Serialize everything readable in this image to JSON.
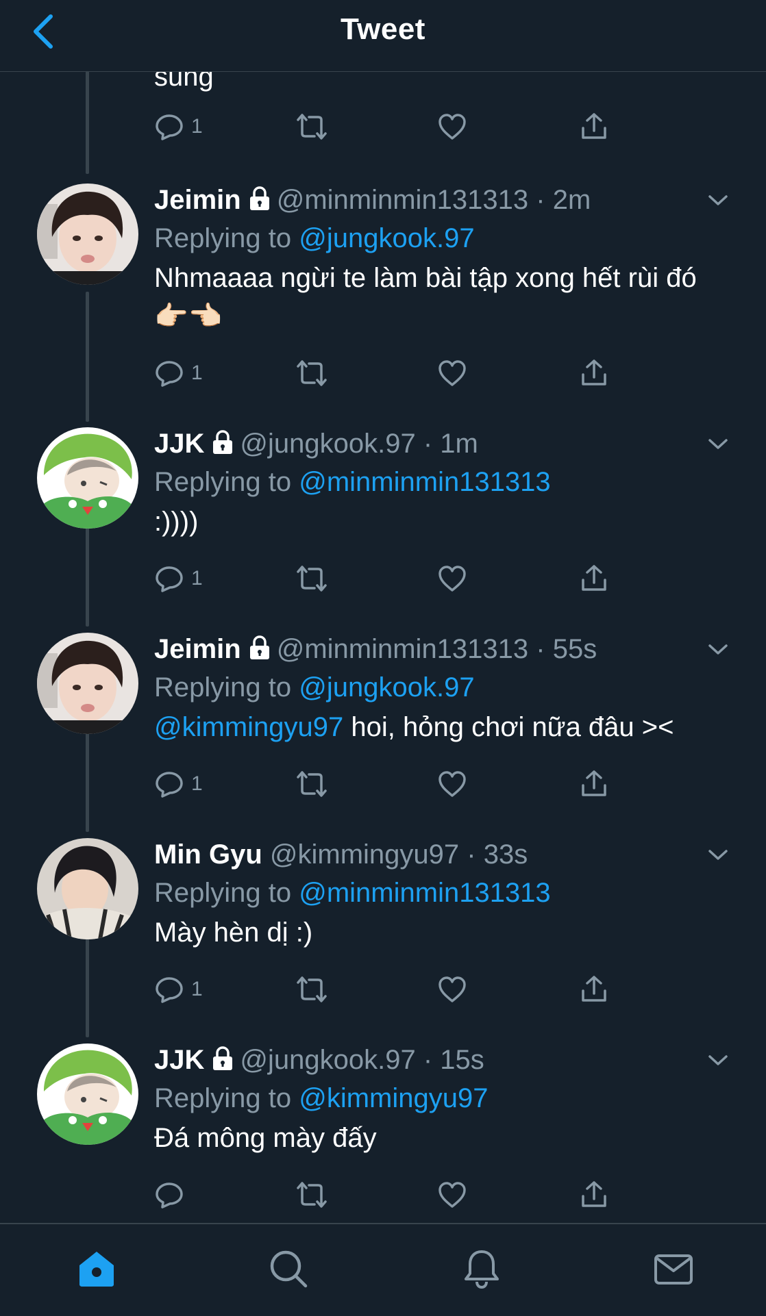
{
  "header": {
    "title": "Tweet"
  },
  "top_partial": {
    "text": "sung",
    "reply_count": "1"
  },
  "tweets": [
    {
      "name": "Jeimin",
      "handle": "@minminmin131313",
      "time": "2m",
      "replying_prefix": "Replying to ",
      "replying_to": "@jungkook.97",
      "text": "Nhmaaaa ngừi te làm bài tập xong hết rùi đó 👉🏻👈🏻",
      "reply_count": "1"
    },
    {
      "name": "JJK",
      "handle": "@jungkook.97",
      "time": "1m",
      "replying_prefix": "Replying to ",
      "replying_to": "@minminmin131313",
      "text": ":))))",
      "reply_count": "1"
    },
    {
      "name": "Jeimin",
      "handle": "@minminmin131313",
      "time": "55s",
      "replying_prefix": "Replying to ",
      "replying_to": "@jungkook.97",
      "mention": "@kimmingyu97",
      "text": " hoi, hỏng chơi nữa đâu ><",
      "reply_count": "1"
    },
    {
      "name": "Min Gyu",
      "handle": "@kimmingyu97",
      "time": "33s",
      "replying_prefix": "Replying to ",
      "replying_to": "@minminmin131313",
      "text": "Mày hèn dị :)",
      "reply_count": "1"
    },
    {
      "name": "JJK",
      "handle": "@jungkook.97",
      "time": "15s",
      "replying_prefix": "Replying to ",
      "replying_to": "@kimmingyu97",
      "text": "Đá mông mày đấy",
      "reply_count": ""
    }
  ],
  "colors": {
    "background": "#15202b",
    "accent": "#1da1f2",
    "muted": "#8899a6",
    "divider": "#38444d"
  },
  "icons": {
    "header": [
      "back-chevron-icon"
    ],
    "actions": [
      "reply-icon",
      "retweet-icon",
      "like-icon",
      "share-icon"
    ],
    "tabbar": [
      "home-icon",
      "search-icon",
      "notifications-icon",
      "messages-icon"
    ]
  }
}
